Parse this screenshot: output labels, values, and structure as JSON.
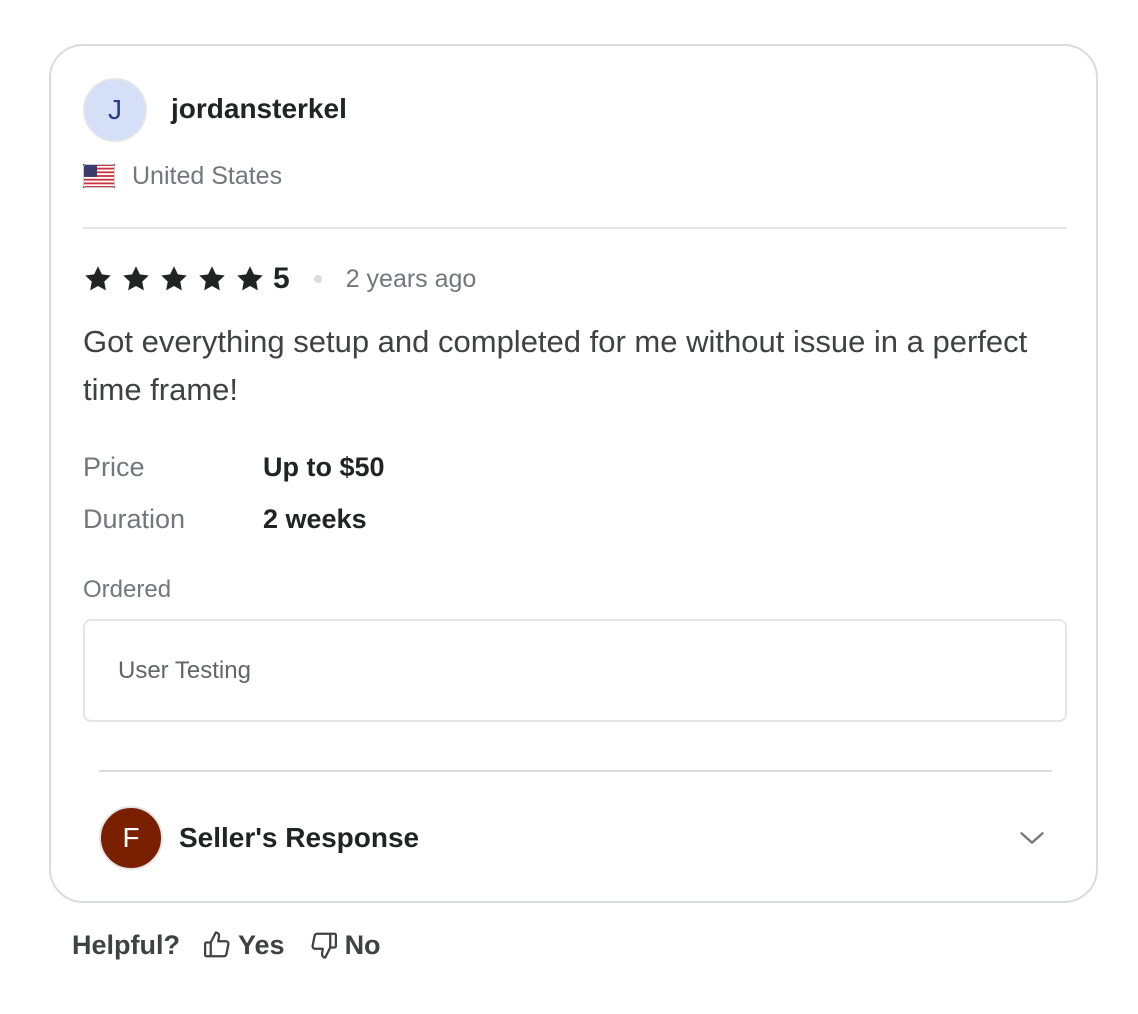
{
  "reviewer": {
    "avatar_initial": "J",
    "username": "jordansterkel",
    "country": "United States",
    "flag_icon": "us-flag-icon"
  },
  "rating": {
    "stars": 5,
    "value": "5",
    "time_ago": "2 years ago"
  },
  "review": {
    "text": "Got everything setup and completed for me without issue in a perfect time frame!"
  },
  "details": {
    "price_label": "Price",
    "price_value": "Up to $50",
    "duration_label": "Duration",
    "duration_value": "2 weeks"
  },
  "ordered": {
    "label": "Ordered",
    "item": "User Testing"
  },
  "seller_response": {
    "avatar_initial": "F",
    "title": "Seller's Response",
    "expanded": false
  },
  "helpful": {
    "label": "Helpful?",
    "yes_label": "Yes",
    "no_label": "No"
  },
  "colors": {
    "star": "#222325",
    "seller_avatar": "#7a1f00",
    "reviewer_avatar": "#d5dff7"
  }
}
